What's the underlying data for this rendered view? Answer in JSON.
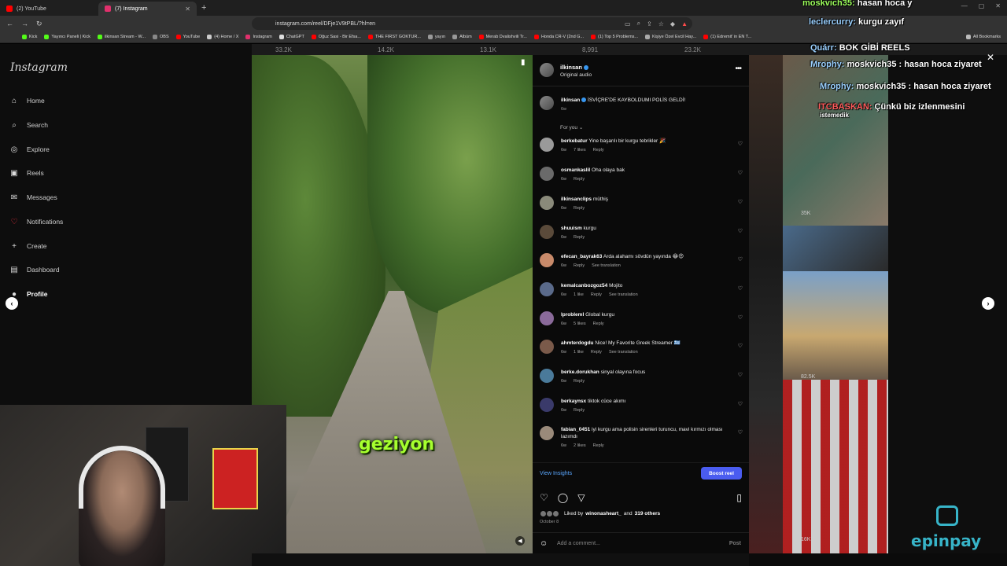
{
  "browser": {
    "tabs": [
      {
        "label": "(2) YouTube",
        "color": "#ff0000"
      },
      {
        "label": "(7) Instagram",
        "color": "#e1306c"
      }
    ],
    "url": "instagram.com/reel/DFje1V9tPBL/?hl=en",
    "bookmarks": [
      "Kick",
      "Yayıncı Paneli | Kick",
      "ilkinsan Stream - W...",
      "OBS",
      "YouTube",
      "(4) Home / X",
      "Instagram",
      "ChatGPT",
      "Oğuz Sasi - Bir Efsa...",
      "THE FIRST GOKTUR...",
      "yayın",
      "Albüm",
      "Merab Dvalishvili Tr...",
      "Honda CR-V (2nd G...",
      "(1) Top 5 Problems...",
      "Kişiye Özel Evcil Hay...",
      "(1) Edremit' in EN T...",
      "All Bookmarks"
    ]
  },
  "instagram": {
    "logo": "Instagram",
    "nav": [
      {
        "label": "Home",
        "icon": "home-icon",
        "glyph": "⌂"
      },
      {
        "label": "Search",
        "icon": "search-icon",
        "glyph": "⌕"
      },
      {
        "label": "Explore",
        "icon": "compass-icon",
        "glyph": "◎"
      },
      {
        "label": "Reels",
        "icon": "reels-icon",
        "glyph": "▣"
      },
      {
        "label": "Messages",
        "icon": "messenger-icon",
        "glyph": "✉"
      },
      {
        "label": "Notifications",
        "icon": "heart-icon",
        "glyph": "♡"
      },
      {
        "label": "Create",
        "icon": "plus-icon",
        "glyph": "+"
      },
      {
        "label": "Dashboard",
        "icon": "dashboard-icon",
        "glyph": "▤"
      },
      {
        "label": "Profile",
        "icon": "profile-icon",
        "glyph": "●"
      }
    ],
    "top_counts": [
      "33.2K",
      "14.2K",
      "13.1K",
      "8,991",
      "23.2K"
    ]
  },
  "video": {
    "caption": "geziyon"
  },
  "panel": {
    "username": "ilkinsan",
    "audio": "Original audio",
    "caption_user": "ilkinsan",
    "caption_text": "İSVİÇRE'DE KAYBOLDUMI POLİS GELDİ!",
    "caption_time": "6w",
    "for_you": "For you ⌄",
    "comments": [
      {
        "user": "berkebatur",
        "text": "Yine başarılı bir kurgu tebrikler 🎉",
        "time": "6w",
        "likes": "7 likes",
        "reply": "Reply",
        "translate": ""
      },
      {
        "user": "osmankaslil",
        "text": "Oha olaya bak",
        "time": "6w",
        "likes": "",
        "reply": "Reply",
        "translate": ""
      },
      {
        "user": "ilkinsanclips",
        "text": "müthiş",
        "time": "6w",
        "likes": "",
        "reply": "Reply",
        "translate": ""
      },
      {
        "user": "shuuism",
        "text": "kurgu",
        "time": "6w",
        "likes": "",
        "reply": "Reply",
        "translate": ""
      },
      {
        "user": "efecan_bayrak63",
        "text": "Arda alahamı sövdün yayında 😂😍",
        "time": "6w",
        "likes": "",
        "reply": "Reply",
        "translate": "See translation"
      },
      {
        "user": "kemalcanbozgoz54",
        "text": "Mojito",
        "time": "6w",
        "likes": "1 like",
        "reply": "Reply",
        "translate": "See translation"
      },
      {
        "user": "lproblemI",
        "text": "Global kurgu",
        "time": "6w",
        "likes": "5 likes",
        "reply": "Reply",
        "translate": ""
      },
      {
        "user": "ahmterdogdu",
        "text": "Nice! My Favorite Greek Streamer 🇬🇷",
        "time": "6w",
        "likes": "1 like",
        "reply": "Reply",
        "translate": "See translation"
      },
      {
        "user": "berke.dorukhan",
        "text": "sinyal olayına focus",
        "time": "6w",
        "likes": "",
        "reply": "Reply",
        "translate": ""
      },
      {
        "user": "berkaynsx",
        "text": "tiktok cüce akımı",
        "time": "6w",
        "likes": "",
        "reply": "Reply",
        "translate": ""
      },
      {
        "user": "fabian_0451",
        "text": "iyi kurgu ama polisin sirenleri turuncu, mavi kırmızı olması lazımdı",
        "time": "6w",
        "likes": "2 likes",
        "reply": "Reply",
        "translate": ""
      }
    ],
    "view_insights": "View Insights",
    "boost": "Boost reel",
    "liked_by_prefix": "Liked by",
    "liked_by_user": "winonasheart_",
    "liked_by_suffix": "and",
    "liked_by_others": "319 others",
    "date": "October 8",
    "add_comment_placeholder": "Add a comment...",
    "post": "Post"
  },
  "right_tiles": {
    "counts": [
      "35K",
      "82.5K",
      "16K"
    ]
  },
  "chat": [
    {
      "user": "moskvich35:",
      "msg": "hasan hoca y",
      "color": "green"
    },
    {
      "user": "leclercurry:",
      "msg": "kurgu zayıf",
      "color": "blue"
    },
    {
      "user": "Quárr:",
      "msg": "BOK GİBİ REELS",
      "color": "blue"
    },
    {
      "user": "Mrophy:",
      "msg": "moskvich35 : hasan hoca ziyaret",
      "color": "blue"
    },
    {
      "user": "Mrophy:",
      "msg": "moskvich35 : hasan hoca ziyaret",
      "color": "blue"
    },
    {
      "user": "ITCBASKAN:",
      "msg": "Çünkü biz izlenmesini",
      "color": "red"
    },
    {
      "user": "",
      "msg": "istemedik",
      "color": "blue"
    }
  ],
  "overlay": {
    "sponsor": "epinpay"
  }
}
